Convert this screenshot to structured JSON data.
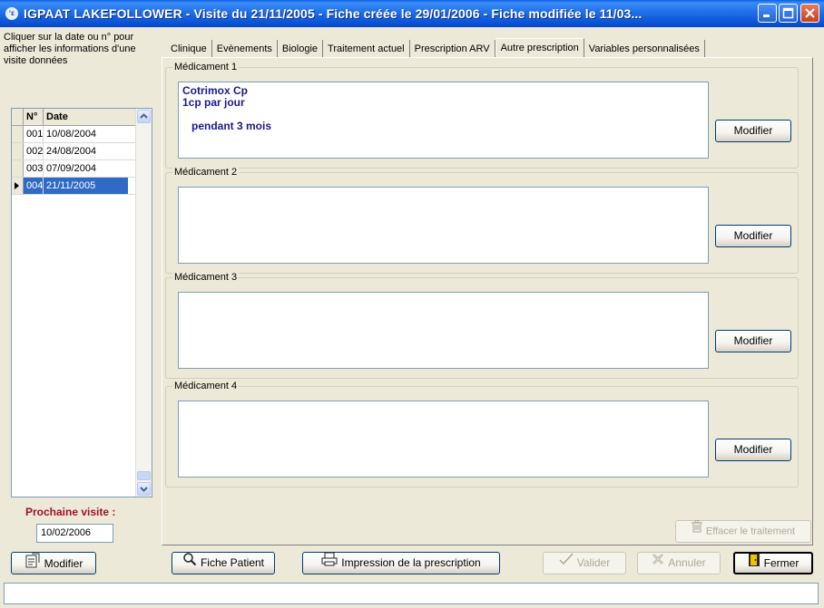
{
  "window": {
    "title": "IGPAAT LAKEFOLLOWER - Visite du 21/11/2005 - Fiche créée le 29/01/2006 - Fiche modifiée le 11/03...",
    "app_icon_text": "ʻɛ",
    "accent": "#0a52d6"
  },
  "left_panel": {
    "hint": "Cliquer sur la date ou n° pour afficher les informations d'une visite données",
    "columns": [
      "N°",
      "Date"
    ],
    "visits": [
      {
        "n": "001",
        "date": "10/08/2004"
      },
      {
        "n": "002",
        "date": "24/08/2004"
      },
      {
        "n": "003",
        "date": "07/09/2004"
      },
      {
        "n": "004",
        "date": "21/11/2005"
      }
    ],
    "selected_index": 3,
    "next_visit_label": "Prochaine visite :",
    "next_visit_value": "10/02/2006",
    "next_visit_color": "#a0122a"
  },
  "tabs": [
    "Clinique",
    "Evènements",
    "Biologie",
    "Traitement actuel",
    "Prescription ARV",
    "Autre prescription",
    "Variables personnalisées"
  ],
  "active_tab": "Autre prescription",
  "medications": [
    {
      "legend": "Médicament 1",
      "lines": [
        "Cotrimox Cp",
        "1cp par jour",
        "",
        "   pendant 3 mois"
      ],
      "button": "Modifier"
    },
    {
      "legend": "Médicament 2",
      "lines": [],
      "button": "Modifier"
    },
    {
      "legend": "Médicament 3",
      "lines": [],
      "button": "Modifier"
    },
    {
      "legend": "Médicament 4",
      "lines": [],
      "button": "Modifier"
    }
  ],
  "clear_button": "Effacer le traitement",
  "bottom_buttons": {
    "modifier": "Modifier",
    "fiche_patient": "Fiche Patient",
    "impression": "Impression de la prescription",
    "valider": "Valider",
    "annuler": "Annuler",
    "fermer": "Fermer"
  },
  "icons": {
    "modifier": "edit-sheet-icon",
    "fiche_patient": "magnifier-icon",
    "impression": "printer-icon",
    "valider": "checkmark-icon",
    "annuler": "cancel-x-icon",
    "fermer": "exit-door-icon",
    "effacer": "trash-icon"
  }
}
